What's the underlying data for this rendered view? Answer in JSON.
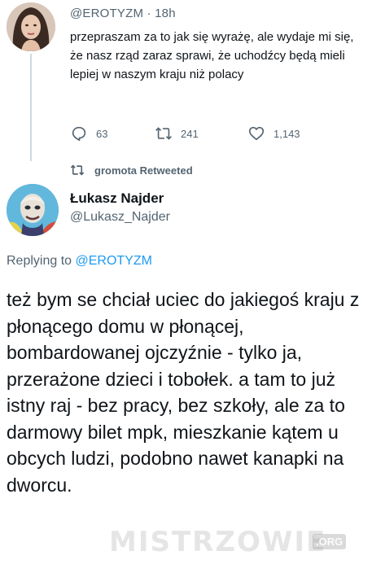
{
  "original_tweet": {
    "handle": "@EROTYZM",
    "separator": "·",
    "time": "18h",
    "text": "przepraszam za to jak się wyrażę, ale wydaje mi się, że nasz rząd zaraz sprawi, że uchodźcy będą mieli lepiej w naszym kraju niż polacy",
    "replies": "63",
    "retweets": "241",
    "likes": "1,143",
    "icons": {
      "reply": "reply-icon",
      "retweet": "retweet-icon",
      "like": "heart-icon"
    }
  },
  "retweet_context": {
    "label": "gromota Retweeted",
    "icon": "retweet-icon"
  },
  "reply_tweet": {
    "name": "Łukasz Najder",
    "handle": "@Lukasz_Najder",
    "replying_prefix": "Replying to",
    "replying_to": "@EROTYZM",
    "text": "też bym se chciał uciec do jakiegoś kraju z płonącego domu w płonącej, bombardowanej ojczyźnie - tylko ja, przerażone dzieci i tobołek. a tam to już istny raj - bez pracy, bez szkoły, ale za to darmowy bilet mpk, mieszkanie kątem u obcych ludzi, podobno nawet kanapki na dworcu."
  },
  "watermark": {
    "text": "MISTRZOWIE",
    "suffix": ".ORG"
  },
  "colors": {
    "text": "#0f1419",
    "secondary": "#536471",
    "link": "#1d9bf0",
    "thread_line": "#cfd9de"
  }
}
